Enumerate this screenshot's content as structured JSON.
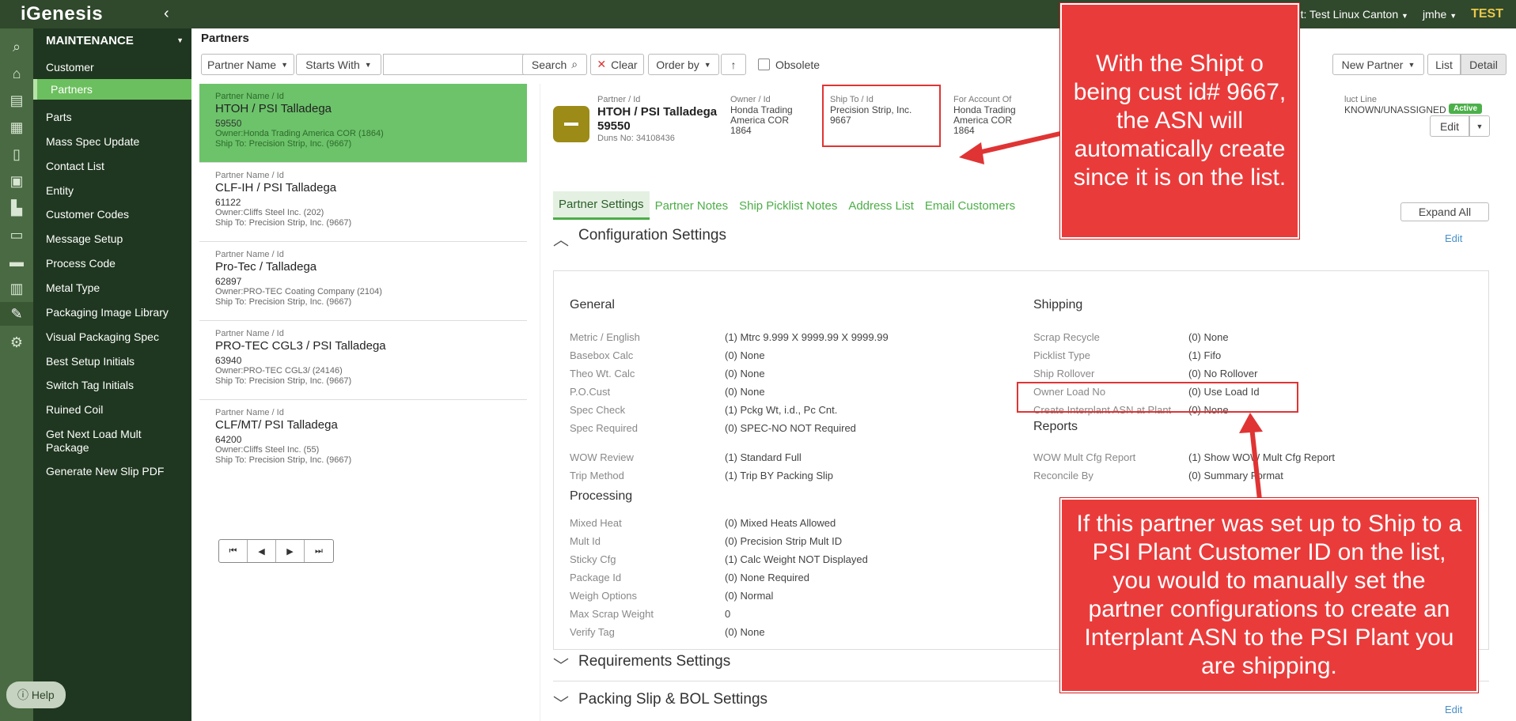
{
  "topbar": {
    "logo": "iGenesis",
    "client": "nt: Test Linux Canton",
    "user": "jmhe",
    "env": "TEST"
  },
  "menu": {
    "title": "MAINTENANCE",
    "items": [
      {
        "label": "Customer"
      },
      {
        "label": "Partners"
      },
      {
        "label": "Parts"
      },
      {
        "label": "Mass Spec Update"
      },
      {
        "label": "Contact List"
      },
      {
        "label": "Entity"
      },
      {
        "label": "Customer Codes"
      },
      {
        "label": "Message Setup"
      },
      {
        "label": "Process Code"
      },
      {
        "label": "Metal Type"
      },
      {
        "label": "Packaging Image Library"
      },
      {
        "label": "Visual Packaging Spec"
      },
      {
        "label": "Best Setup Initials"
      },
      {
        "label": "Switch Tag Initials"
      },
      {
        "label": "Ruined Coil"
      },
      {
        "label": "Get Next Load Mult Package"
      },
      {
        "label": "Generate New Slip PDF"
      }
    ],
    "help": "Help"
  },
  "toolbar": {
    "page_title": "Partners",
    "field_select": "Partner Name",
    "match_select": "Starts With",
    "search": "Search",
    "clear": "Clear",
    "order_by": "Order by",
    "obsolete": "Obsolete",
    "new_partner": "New Partner",
    "list": "List",
    "detail": "Detail"
  },
  "partners": [
    {
      "cap": "Partner Name / Id",
      "name": "HTOH / PSI Talladega",
      "id": "59550",
      "owner": "Owner:Honda Trading America COR (1864)",
      "ship": "Ship To: Precision Strip, Inc. (9667)"
    },
    {
      "cap": "Partner Name / Id",
      "name": "CLF-IH / PSI Talladega",
      "id": "61122",
      "owner": "Owner:Cliffs Steel Inc. (202)",
      "ship": "Ship To: Precision Strip, Inc. (9667)"
    },
    {
      "cap": "Partner Name / Id",
      "name": "Pro-Tec / Talladega",
      "id": "62897",
      "owner": "Owner:PRO-TEC Coating Company (2104)",
      "ship": "Ship To: Precision Strip, Inc. (9667)"
    },
    {
      "cap": "Partner Name / Id",
      "name": "PRO-TEC CGL3 / PSI Talladega",
      "id": "63940",
      "owner": "Owner:PRO-TEC CGL3/ (24146)",
      "ship": "Ship To: Precision Strip, Inc. (9667)"
    },
    {
      "cap": "Partner Name / Id",
      "name": "CLF/MT/ PSI Talladega",
      "id": "64200",
      "owner": "Owner:Cliffs Steel Inc. (55)",
      "ship": "Ship To: Precision Strip, Inc. (9667)"
    }
  ],
  "detail": {
    "name_cap": "Partner / Id",
    "name": "HTOH / PSI Talladega",
    "id": "59550",
    "duns": "Duns No: 34108436",
    "owner_cap": "Owner / Id",
    "owner_1": "Honda Trading",
    "owner_2": "America COR",
    "owner_3": "1864",
    "shipto_cap": "Ship To / Id",
    "shipto_1": "Precision Strip, Inc.",
    "shipto_2": "9667",
    "account_cap": "For Account Of",
    "account_1": "Honda Trading",
    "account_2": "America COR",
    "account_3": "1864",
    "product_cap": "luct Line",
    "product": "KNOWN/UNASSIGNED",
    "status": "Active",
    "edit": "Edit"
  },
  "tabs": [
    "Partner Settings",
    "Partner Notes",
    "Ship Picklist Notes",
    "Address List",
    "Email Customers"
  ],
  "config": {
    "expand_all": "Expand All",
    "title": "Configuration Settings",
    "edit": "Edit",
    "general": "General",
    "shipping": "Shipping",
    "reports": "Reports",
    "processing": "Processing",
    "general_rows": [
      {
        "label": "Metric / English",
        "value": "(1) Mtrc 9.999 X 9999.99 X 9999.99"
      },
      {
        "label": "Basebox Calc",
        "value": "(0) None"
      },
      {
        "label": "Theo Wt. Calc",
        "value": "(0) None"
      },
      {
        "label": "P.O.Cust",
        "value": "(0) None"
      },
      {
        "label": "Spec Check",
        "value": "(1) Pckg Wt, i.d., Pc Cnt."
      },
      {
        "label": "Spec Required",
        "value": "(0) SPEC-NO NOT Required"
      },
      {
        "label": "WOW Review",
        "value": "(1) Standard Full"
      },
      {
        "label": "Trip Method",
        "value": "(1) Trip BY Packing Slip"
      }
    ],
    "shipping_rows": [
      {
        "label": "Scrap Recycle",
        "value": "(0) None"
      },
      {
        "label": "Picklist Type",
        "value": "(1) Fifo"
      },
      {
        "label": "Ship Rollover",
        "value": "(0) No Rollover"
      },
      {
        "label": "Owner Load No",
        "value": "(0) Use Load Id"
      },
      {
        "label": "Create Interplant ASN at Plant",
        "value": "(0) None"
      }
    ],
    "report_rows": [
      {
        "label": "WOW Mult Cfg Report",
        "value": "(1) Show WOW Mult Cfg Report"
      },
      {
        "label": "Reconcile By",
        "value": "(0) Summary Format"
      }
    ],
    "processing_rows": [
      {
        "label": "Mixed Heat",
        "value": "(0) Mixed Heats Allowed"
      },
      {
        "label": "Mult Id",
        "value": "(0) Precision Strip Mult ID"
      },
      {
        "label": "Sticky Cfg",
        "value": "(1) Calc Weight NOT Displayed"
      },
      {
        "label": "Package Id",
        "value": "(0) None Required"
      },
      {
        "label": "Weigh Options",
        "value": "(0) Normal"
      },
      {
        "label": "Max Scrap Weight",
        "value": "0"
      },
      {
        "label": "Verify Tag",
        "value": "(0) None"
      }
    ]
  },
  "sections": {
    "requirements": "Requirements Settings",
    "packing": "Packing Slip & BOL Settings",
    "packing_edit": "Edit"
  },
  "annotations": {
    "top": "With the Shipt o being cust id# 9667, the ASN will automatically create since it is on the list.",
    "bottom": "If this partner was set up to Ship to a PSI Plant Customer ID on the list, you would to manually set the partner configurations to create an Interplant ASN to the PSI Plant you are shipping."
  },
  "colors": {
    "accent": "#4cae48",
    "nav_bg": "#1f3720",
    "callout": "#ea3b3b",
    "env": "#e8c84a"
  }
}
